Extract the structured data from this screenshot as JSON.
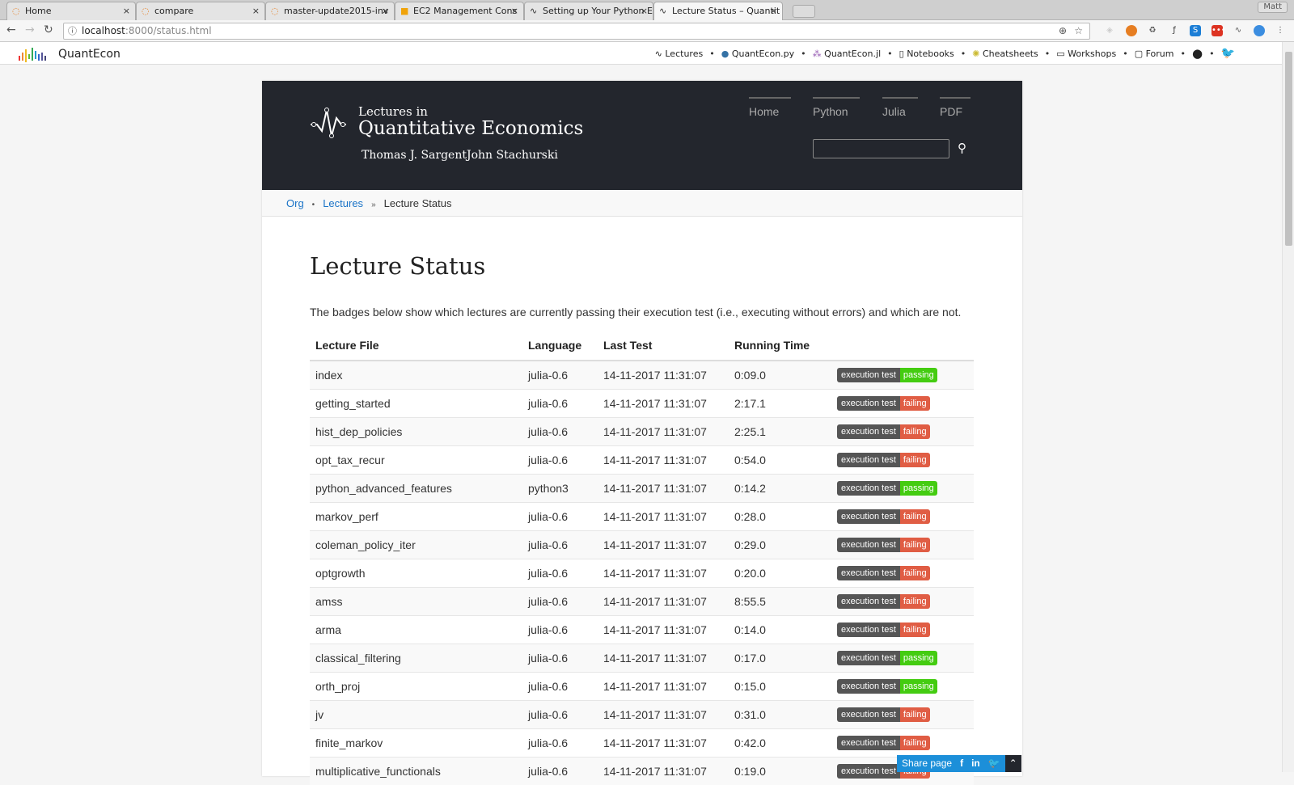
{
  "browser": {
    "tabs": [
      {
        "title": "Home",
        "icon": "jupyter-icon"
      },
      {
        "title": "compare",
        "icon": "jupyter-icon"
      },
      {
        "title": "master-update2015-inv",
        "icon": "jupyter-icon"
      },
      {
        "title": "EC2 Management Cons",
        "icon": "aws-icon"
      },
      {
        "title": "Setting up Your Python E",
        "icon": "quantecon-icon"
      },
      {
        "title": "Lecture Status – Quantit",
        "icon": "quantecon-icon"
      }
    ],
    "user": "Matt",
    "url_host": "localhost",
    "url_path": ":8000/status.html"
  },
  "topbar": {
    "logo": "QuantEcon",
    "links": [
      {
        "label": "Lectures",
        "icon": "pulse-icon"
      },
      {
        "label": "QuantEcon.py",
        "icon": "python-icon"
      },
      {
        "label": "QuantEcon.jl",
        "icon": "julia-icon"
      },
      {
        "label": "Notebooks",
        "icon": "notebook-icon"
      },
      {
        "label": "Cheatsheets",
        "icon": "bulb-icon"
      },
      {
        "label": "Workshops",
        "icon": "laptop-icon"
      },
      {
        "label": "Forum",
        "icon": "chat-icon"
      }
    ]
  },
  "header": {
    "subtitle": "Lectures in",
    "title": "Quantitative Economics",
    "authors": [
      "Thomas J. Sargent",
      "John Stachurski"
    ],
    "nav": [
      "Home",
      "Python",
      "Julia",
      "PDF"
    ],
    "search_value": ""
  },
  "breadcrumb": {
    "items": [
      "Org",
      "Lectures"
    ],
    "current": "Lecture Status"
  },
  "page": {
    "title": "Lecture Status",
    "description": "The badges below show which lectures are currently passing their execution test (i.e., executing without errors) and which are not."
  },
  "table": {
    "headers": [
      "Lecture File",
      "Language",
      "Last Test",
      "Running Time"
    ],
    "badge_label": "execution test",
    "colors": {
      "passing": "#4c1",
      "failing": "#e05d44"
    },
    "rows": [
      [
        "index",
        "julia-0.6",
        "14-11-2017 11:31:07",
        "0:09.0",
        "passing"
      ],
      [
        "getting_started",
        "julia-0.6",
        "14-11-2017 11:31:07",
        "2:17.1",
        "failing"
      ],
      [
        "hist_dep_policies",
        "julia-0.6",
        "14-11-2017 11:31:07",
        "2:25.1",
        "failing"
      ],
      [
        "opt_tax_recur",
        "julia-0.6",
        "14-11-2017 11:31:07",
        "0:54.0",
        "failing"
      ],
      [
        "python_advanced_features",
        "python3",
        "14-11-2017 11:31:07",
        "0:14.2",
        "passing"
      ],
      [
        "markov_perf",
        "julia-0.6",
        "14-11-2017 11:31:07",
        "0:28.0",
        "failing"
      ],
      [
        "coleman_policy_iter",
        "julia-0.6",
        "14-11-2017 11:31:07",
        "0:29.0",
        "failing"
      ],
      [
        "optgrowth",
        "julia-0.6",
        "14-11-2017 11:31:07",
        "0:20.0",
        "failing"
      ],
      [
        "amss",
        "julia-0.6",
        "14-11-2017 11:31:07",
        "8:55.5",
        "failing"
      ],
      [
        "arma",
        "julia-0.6",
        "14-11-2017 11:31:07",
        "0:14.0",
        "failing"
      ],
      [
        "classical_filtering",
        "julia-0.6",
        "14-11-2017 11:31:07",
        "0:17.0",
        "passing"
      ],
      [
        "orth_proj",
        "julia-0.6",
        "14-11-2017 11:31:07",
        "0:15.0",
        "passing"
      ],
      [
        "jv",
        "julia-0.6",
        "14-11-2017 11:31:07",
        "0:31.0",
        "failing"
      ],
      [
        "finite_markov",
        "julia-0.6",
        "14-11-2017 11:31:07",
        "0:42.0",
        "failing"
      ],
      [
        "multiplicative_functionals",
        "julia-0.6",
        "14-11-2017 11:31:07",
        "0:19.0",
        "failing"
      ]
    ]
  },
  "share": {
    "label": "Share page"
  }
}
